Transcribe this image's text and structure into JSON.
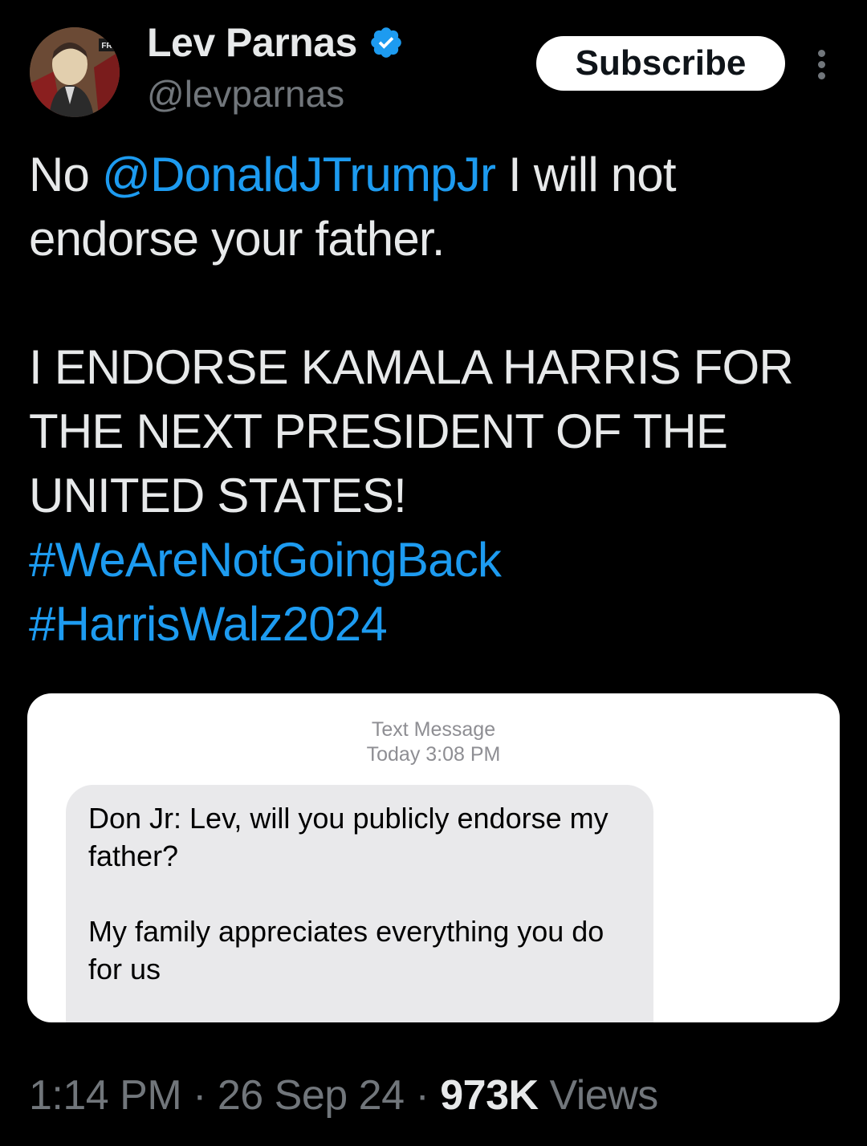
{
  "author": {
    "name": "Lev Parnas",
    "handle": "@levparnas",
    "verified": true,
    "avatar_badge_text": "FR"
  },
  "actions": {
    "subscribe_label": "Subscribe",
    "more_icon": "more-vertical-icon"
  },
  "tweet": {
    "line1_prefix": "No ",
    "mention": "@DonaldJTrumpJr",
    "line1_suffix": " I will not endorse your father.",
    "endorsement": "I ENDORSE KAMALA HARRIS FOR THE NEXT PRESIDENT OF THE UNITED STATES!",
    "hashtags": [
      "#WeAreNotGoingBack",
      "#HarrisWalz2024"
    ]
  },
  "media": {
    "header_title": "Text Message",
    "header_time": "Today 3:08 PM",
    "message_paragraphs": [
      "Don Jr: Lev, will you publicly endorse my father?",
      "My family appreciates everything you do for us"
    ]
  },
  "meta": {
    "time": "1:14 PM",
    "separator": "·",
    "date": "26 Sep 24",
    "views_count": "973K",
    "views_label": "Views"
  },
  "colors": {
    "background": "#000000",
    "text": "#e7e9ea",
    "secondary": "#71767b",
    "link": "#1d9bf0",
    "bubble": "#e9e9eb"
  }
}
